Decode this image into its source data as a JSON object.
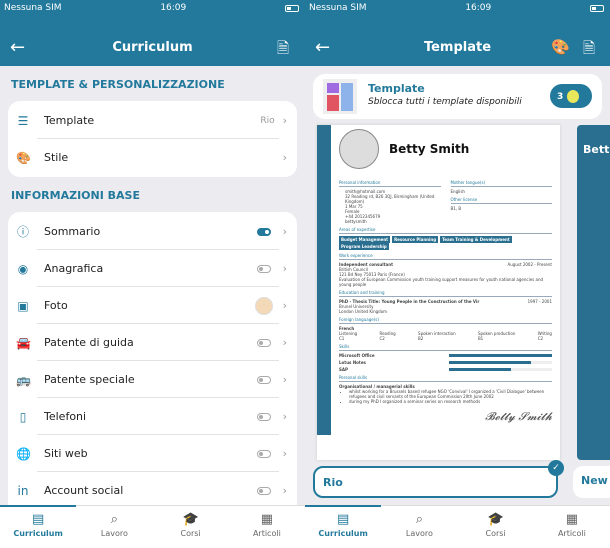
{
  "status": {
    "carrier": "Nessuna SIM",
    "time": "16:09"
  },
  "left": {
    "title": "Curriculum",
    "section1": "TEMPLATE & PERSONALIZZAZIONE",
    "template_label": "Template",
    "template_value": "Rio",
    "stile_label": "Stile",
    "section2": "INFORMAZIONI BASE",
    "items": [
      {
        "label": "Sommario",
        "icon": "info-icon",
        "toggle": true
      },
      {
        "label": "Anagrafica",
        "icon": "user-icon",
        "toggle": false
      },
      {
        "label": "Foto",
        "icon": "image-icon",
        "toggle": null
      },
      {
        "label": "Patente di guida",
        "icon": "car-icon",
        "toggle": false
      },
      {
        "label": "Patente speciale",
        "icon": "bus-icon",
        "toggle": false
      },
      {
        "label": "Telefoni",
        "icon": "phone-icon",
        "toggle": false
      },
      {
        "label": "Siti web",
        "icon": "globe-icon",
        "toggle": false
      },
      {
        "label": "Account social",
        "icon": "linkedin-icon",
        "toggle": false
      }
    ]
  },
  "right": {
    "title": "Template",
    "promo_title": "Template",
    "promo_subtitle": "Sblocca tutti i template disponibili",
    "promo_count": "3",
    "selected": "Rio",
    "next": "New",
    "cv": {
      "name": "Betty Smith",
      "personal": "Personal information",
      "mother": "Mother tongue(s)",
      "contacts": [
        "smith@hotmail.com",
        "32 Reading rd, B26 3QJ, Birmingham (United Kingdom)",
        "1 Mar 75",
        "Female",
        "+44 2012345679",
        "bettysmith"
      ],
      "lang": "English",
      "other": "Other license",
      "license": "B1, B",
      "areas": "Areas of expertise",
      "pills": [
        "Budget Management",
        "Resource Planning",
        "Team Training & Development",
        "Program Leadership"
      ],
      "work": "Work experience",
      "job": "Independent consultant",
      "job_date": "August 2002 - Present",
      "employer": "British Council",
      "job_addr": "121 Bd Ney 75013 Paris (France)",
      "job_desc": "Evaluation of European Commission youth training support measures for youth national agencies and young people",
      "edu": "Education and training",
      "degree": "PhD - Thesis Title: Young People in the Construction of the Vir",
      "edu_date": "1997 - 2001",
      "uni": "Brunel University",
      "uni_addr": "London United Kingdom",
      "foreign": "Foreign language(s)",
      "fl": "French",
      "fl_cols": [
        "Listening",
        "Reading",
        "Spoken interaction",
        "Spoken production",
        "Writing"
      ],
      "fl_vals": [
        "C1",
        "C2",
        "B2",
        "B1",
        "C2"
      ],
      "skills": "Skills",
      "skill_list": [
        {
          "name": "Microsoft Office",
          "level": 1.0
        },
        {
          "name": "Lotus Notes",
          "level": 0.8
        },
        {
          "name": "SAP",
          "level": 0.6
        }
      ],
      "personal_skills": "Personal skills",
      "org": "Organisational / managerial skills",
      "bullets": [
        "whilst working for a Brussels based refugee NGO 'Convival' I organized a 'Civil Dialogue' between refugees and civil servants of the European Commission 20th June 2002",
        "during my PhD I organized a seminar series on research methods"
      ]
    }
  },
  "tabs": [
    {
      "label": "Curriculum",
      "icon": "document-icon"
    },
    {
      "label": "Lavoro",
      "icon": "briefcase-search-icon"
    },
    {
      "label": "Corsi",
      "icon": "graduation-cap-icon"
    },
    {
      "label": "Articoli",
      "icon": "newspaper-icon"
    }
  ],
  "colors": {
    "primary": "#22799b"
  }
}
